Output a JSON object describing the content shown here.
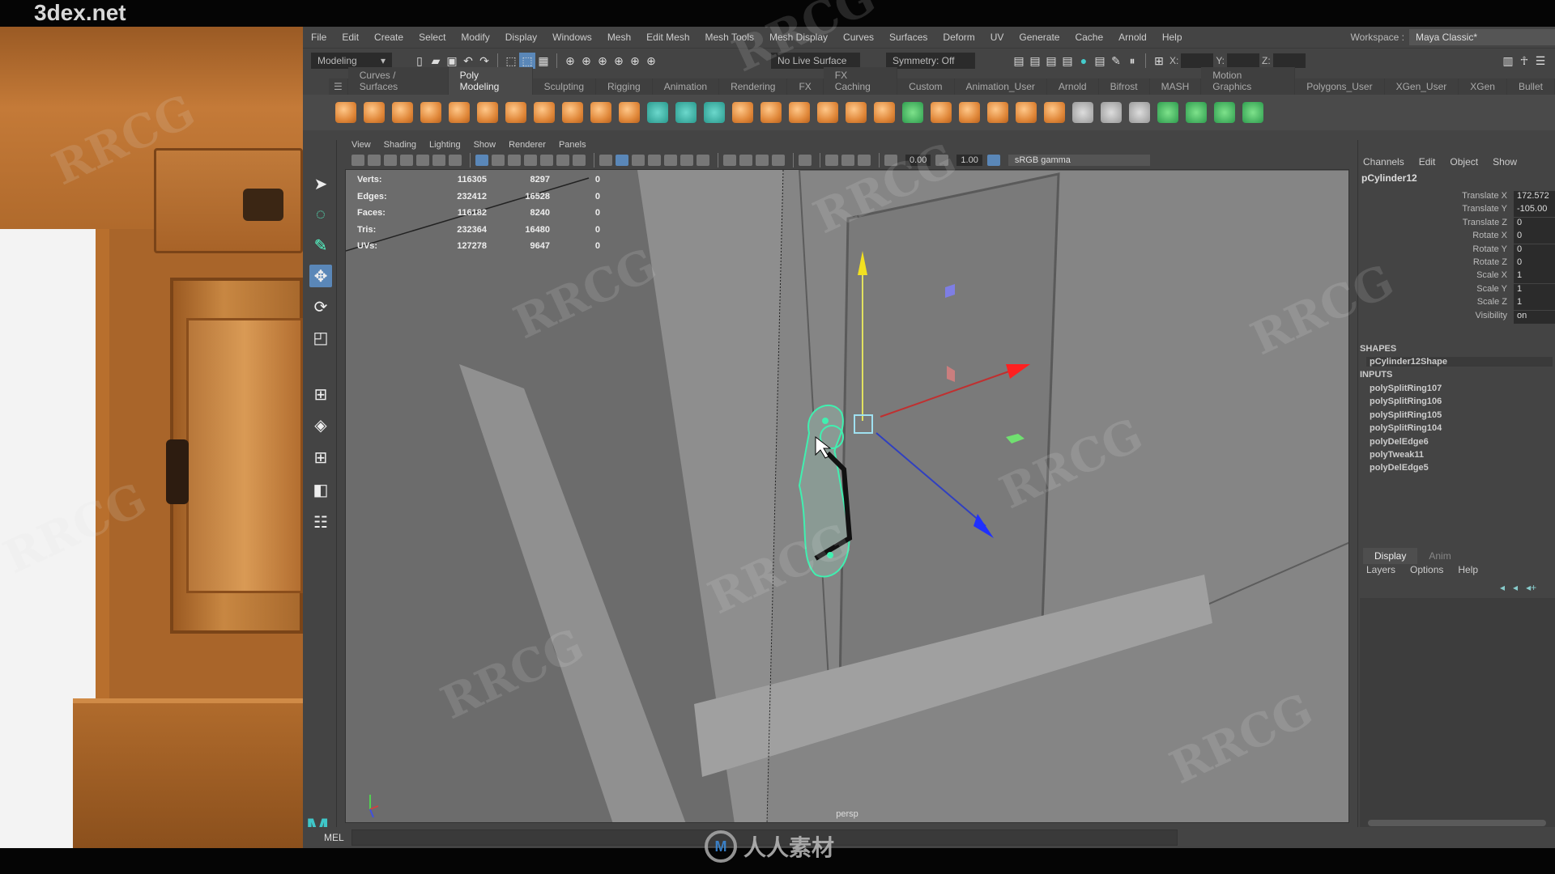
{
  "site_label": "3dex.net",
  "menubar": {
    "items": [
      "File",
      "Edit",
      "Create",
      "Select",
      "Modify",
      "Display",
      "Windows",
      "Mesh",
      "Edit Mesh",
      "Mesh Tools",
      "Mesh Display",
      "Curves",
      "Surfaces",
      "Deform",
      "UV",
      "Generate",
      "Cache",
      "Arnold",
      "Help"
    ],
    "workspace_label": "Workspace :",
    "workspace_value": "Maya Classic*"
  },
  "statusline": {
    "mode": "Modeling",
    "live_surface": "No Live Surface",
    "symmetry": "Symmetry: Off",
    "x_label": "X:",
    "y_label": "Y:",
    "z_label": "Z:"
  },
  "shelf": {
    "tabs": [
      "Curves / Surfaces",
      "Poly Modeling",
      "Sculpting",
      "Rigging",
      "Animation",
      "Rendering",
      "FX",
      "FX Caching",
      "Custom",
      "Animation_User",
      "Arnold",
      "Bifrost",
      "MASH",
      "Motion Graphics",
      "Polygons_User",
      "XGen_User",
      "XGen",
      "Bullet"
    ],
    "active_tab": "Poly Modeling",
    "icons": [
      {
        "name": "poly-sphere-icon",
        "color": "orange"
      },
      {
        "name": "poly-cube-icon",
        "color": "orange"
      },
      {
        "name": "poly-cylinder-icon",
        "color": "orange"
      },
      {
        "name": "poly-cone-icon",
        "color": "orange"
      },
      {
        "name": "poly-torus-icon",
        "color": "orange"
      },
      {
        "name": "poly-plane-icon",
        "color": "orange"
      },
      {
        "name": "poly-disc-icon",
        "color": "orange"
      },
      {
        "name": "platonic-solid-icon",
        "color": "orange"
      },
      {
        "name": "super-shape-icon",
        "color": "orange"
      },
      {
        "name": "type-tool-icon",
        "color": "orange"
      },
      {
        "name": "svg-tool-icon",
        "color": "orange"
      },
      {
        "name": "measure-icon",
        "color": "teal"
      },
      {
        "name": "reset-transform-icon",
        "color": "teal"
      },
      {
        "name": "freeze-transform-icon",
        "color": "teal"
      },
      {
        "name": "combine-icon",
        "color": "orange"
      },
      {
        "name": "separate-icon",
        "color": "orange"
      },
      {
        "name": "extract-icon",
        "color": "orange"
      },
      {
        "name": "booleans-icon",
        "color": "orange"
      },
      {
        "name": "smooth-icon",
        "color": "orange"
      },
      {
        "name": "reduce-icon",
        "color": "orange"
      },
      {
        "name": "mirror-icon",
        "color": "green"
      },
      {
        "name": "extrude-icon",
        "color": "orange"
      },
      {
        "name": "bridge-icon",
        "color": "orange"
      },
      {
        "name": "bevel-icon",
        "color": "orange"
      },
      {
        "name": "append-icon",
        "color": "orange"
      },
      {
        "name": "fill-hole-icon",
        "color": "orange"
      },
      {
        "name": "multi-cut-icon",
        "color": "grey"
      },
      {
        "name": "target-weld-icon",
        "color": "grey"
      },
      {
        "name": "connect-icon",
        "color": "grey"
      },
      {
        "name": "uv-editor-icon",
        "color": "green"
      },
      {
        "name": "planar-map-icon",
        "color": "green"
      },
      {
        "name": "cylindrical-map-icon",
        "color": "green"
      },
      {
        "name": "auto-map-icon",
        "color": "green"
      }
    ]
  },
  "viewport": {
    "menu": [
      "View",
      "Shading",
      "Lighting",
      "Show",
      "Renderer",
      "Panels"
    ],
    "exposure": "0.00",
    "gamma": "1.00",
    "color_space": "sRGB gamma",
    "camera_label": "persp",
    "hud": [
      {
        "label": "Verts:",
        "scene": "116305",
        "selected": "8297",
        "extra": "0"
      },
      {
        "label": "Edges:",
        "scene": "232412",
        "selected": "16528",
        "extra": "0"
      },
      {
        "label": "Faces:",
        "scene": "116182",
        "selected": "8240",
        "extra": "0"
      },
      {
        "label": "Tris:",
        "scene": "232364",
        "selected": "16480",
        "extra": "0"
      },
      {
        "label": "UVs:",
        "scene": "127278",
        "selected": "9647",
        "extra": "0"
      }
    ]
  },
  "channel_box": {
    "menu": [
      "Channels",
      "Edit",
      "Object",
      "Show"
    ],
    "object_name": "pCylinder12",
    "attributes": [
      {
        "name": "Translate X",
        "value": "172.572"
      },
      {
        "name": "Translate Y",
        "value": "-105.00"
      },
      {
        "name": "Translate Z",
        "value": "0"
      },
      {
        "name": "Rotate X",
        "value": "0"
      },
      {
        "name": "Rotate Y",
        "value": "0"
      },
      {
        "name": "Rotate Z",
        "value": "0"
      },
      {
        "name": "Scale X",
        "value": "1"
      },
      {
        "name": "Scale Y",
        "value": "1"
      },
      {
        "name": "Scale Z",
        "value": "1"
      },
      {
        "name": "Visibility",
        "value": "on"
      }
    ],
    "shapes_label": "SHAPES",
    "shape_node": "pCylinder12Shape",
    "inputs_label": "INPUTS",
    "inputs": [
      "polySplitRing107",
      "polySplitRing106",
      "polySplitRing105",
      "polySplitRing104",
      "polyDelEdge6",
      "polyTweak11",
      "polyDelEdge5"
    ],
    "layer_tabs": [
      "Display",
      "Anim"
    ],
    "active_layer_tab": "Display",
    "layer_menu": [
      "Layers",
      "Options",
      "Help"
    ]
  },
  "command_line": {
    "label": "MEL"
  },
  "watermarks": {
    "logo_text": "人人素材",
    "logo_mark": "M",
    "rrcg": "RRCG"
  }
}
